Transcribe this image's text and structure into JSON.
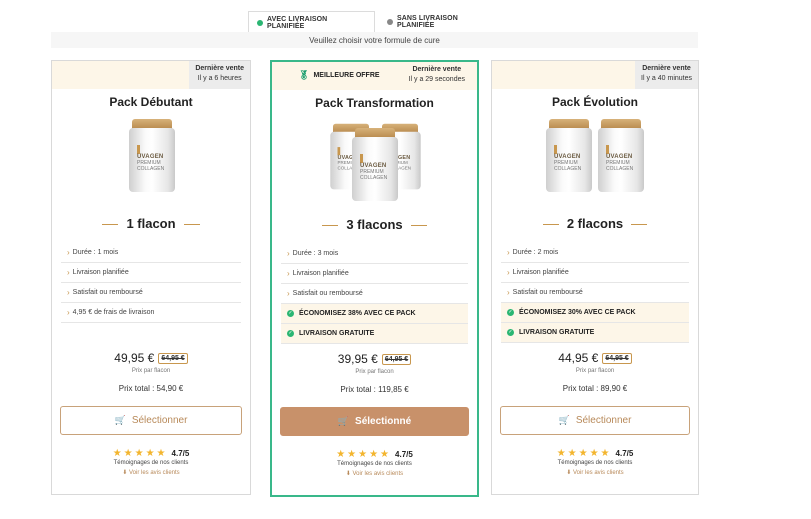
{
  "tabs": [
    {
      "label": "AVEC LIVRAISON PLANIFIÉE",
      "dot_color": "#2bb673"
    },
    {
      "label": "SANS LIVRAISON PLANIFIÉE",
      "dot_color": "#888888"
    }
  ],
  "subtitle": "Veuillez choisir votre formule de cure",
  "colors": {
    "accent": "#c8916a",
    "highlight_border": "#39b88a",
    "check": "#2bb673",
    "star": "#f3b52e"
  },
  "jar_label": {
    "brand": "UVAGEN",
    "line1": "PREMIUM",
    "line2": "COLLAGEN"
  },
  "cards": [
    {
      "vente_title": "Dernière vente",
      "vente_time": "Il y a 6 heures",
      "title": "Pack Débutant",
      "quantity": "1 flacon",
      "features": [
        "Durée : 1 mois",
        "Livraison planifiée",
        "Satisfait ou remboursé",
        "4,95 € de frais de livraison"
      ],
      "price": "49,95 €",
      "old_price": "64,95 €",
      "price_per": "Prix par flacon",
      "total": "Prix total : 54,90 €",
      "button": "Sélectionner",
      "rating": "4.7/5",
      "testimonials": "Témoignages de nos clients",
      "see_reviews": "⬇ Voir les avis clients"
    },
    {
      "badge": "MEILLEURE OFFRE",
      "vente_title": "Dernière vente",
      "vente_time": "Il y a 29 secondes",
      "title": "Pack Transformation",
      "quantity": "3 flacons",
      "features": [
        "Durée : 3 mois",
        "Livraison planifiée",
        "Satisfait ou remboursé"
      ],
      "highlights": [
        "ÉCONOMISEZ 38% AVEC CE PACK",
        "LIVRAISON GRATUITE"
      ],
      "price": "39,95 €",
      "old_price": "64,95 €",
      "price_per": "Prix par flacon",
      "total": "Prix total : 119,85 €",
      "button": "Sélectionné",
      "rating": "4.7/5",
      "testimonials": "Témoignages de nos clients",
      "see_reviews": "⬇ Voir les avis clients"
    },
    {
      "vente_title": "Dernière vente",
      "vente_time": "Il y a 40 minutes",
      "title": "Pack Évolution",
      "quantity": "2 flacons",
      "features": [
        "Durée : 2 mois",
        "Livraison planifiée",
        "Satisfait ou remboursé"
      ],
      "highlights": [
        "ÉCONOMISEZ 30% AVEC CE PACK",
        "LIVRAISON GRATUITE"
      ],
      "price": "44,95 €",
      "old_price": "64,95 €",
      "price_per": "Prix par flacon",
      "total": "Prix total : 89,90 €",
      "button": "Sélectionner",
      "rating": "4.7/5",
      "testimonials": "Témoignages de nos clients",
      "see_reviews": "⬇ Voir les avis clients"
    }
  ],
  "icons": {
    "cart": "cart-icon",
    "star": "star-icon",
    "check": "check-circle-icon",
    "chevron": "chevron-right-icon",
    "medal": "medal-icon"
  }
}
